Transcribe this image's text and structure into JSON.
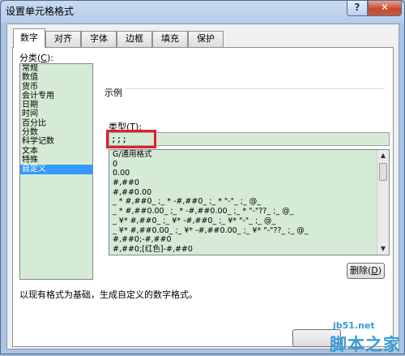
{
  "window": {
    "title": "设置单元格格式",
    "help_label": "?",
    "close_label": "✕"
  },
  "tabs": [
    {
      "label": "数字",
      "active": true
    },
    {
      "label": "对齐",
      "active": false
    },
    {
      "label": "字体",
      "active": false
    },
    {
      "label": "边框",
      "active": false
    },
    {
      "label": "填充",
      "active": false
    },
    {
      "label": "保护",
      "active": false
    }
  ],
  "category": {
    "label_pre": "分类(",
    "label_key": "C",
    "label_post": "):",
    "items": [
      "常规",
      "数值",
      "货币",
      "会计专用",
      "日期",
      "时间",
      "百分比",
      "分数",
      "科学记数",
      "文本",
      "特殊",
      "自定义"
    ],
    "selected": "自定义"
  },
  "sample": {
    "label": "示例"
  },
  "type": {
    "label_pre": "类型(",
    "label_key": "T",
    "label_post": "):",
    "value": ";;;",
    "formats": [
      "G/通用格式",
      "0",
      "0.00",
      "#,##0",
      "#,##0.00",
      "_ * #,##0_ ;_ * -#,##0_ ;_ * \"-\"_ ;_ @_",
      "_ * #,##0.00_ ;_ * -#,##0.00_ ;_ * \"-\"??_ ;_ @_",
      "_ ¥* #,##0_ ;_ ¥* -#,##0_ ;_ ¥* \"-\"_ ;_ @_",
      "_ ¥* #,##0.00_ ;_ ¥* -#,##0.00_ ;_ ¥* \"-\"??_ ;_ @_",
      "#,##0;-#,##0",
      "#,##0;[红色]-#,##0"
    ]
  },
  "delete_button": {
    "label_pre": "删除(",
    "label_key": "D",
    "label_post": ")"
  },
  "description": "以现有格式为基础，生成自定义的数字格式。",
  "ok_button": {
    "label": ""
  },
  "watermark": {
    "line1": "jb51.net",
    "line2": "脚本之家"
  },
  "colors": {
    "list_bg": "#d5ebd5",
    "highlight": "#e0202a",
    "selected": "#3399ff"
  }
}
